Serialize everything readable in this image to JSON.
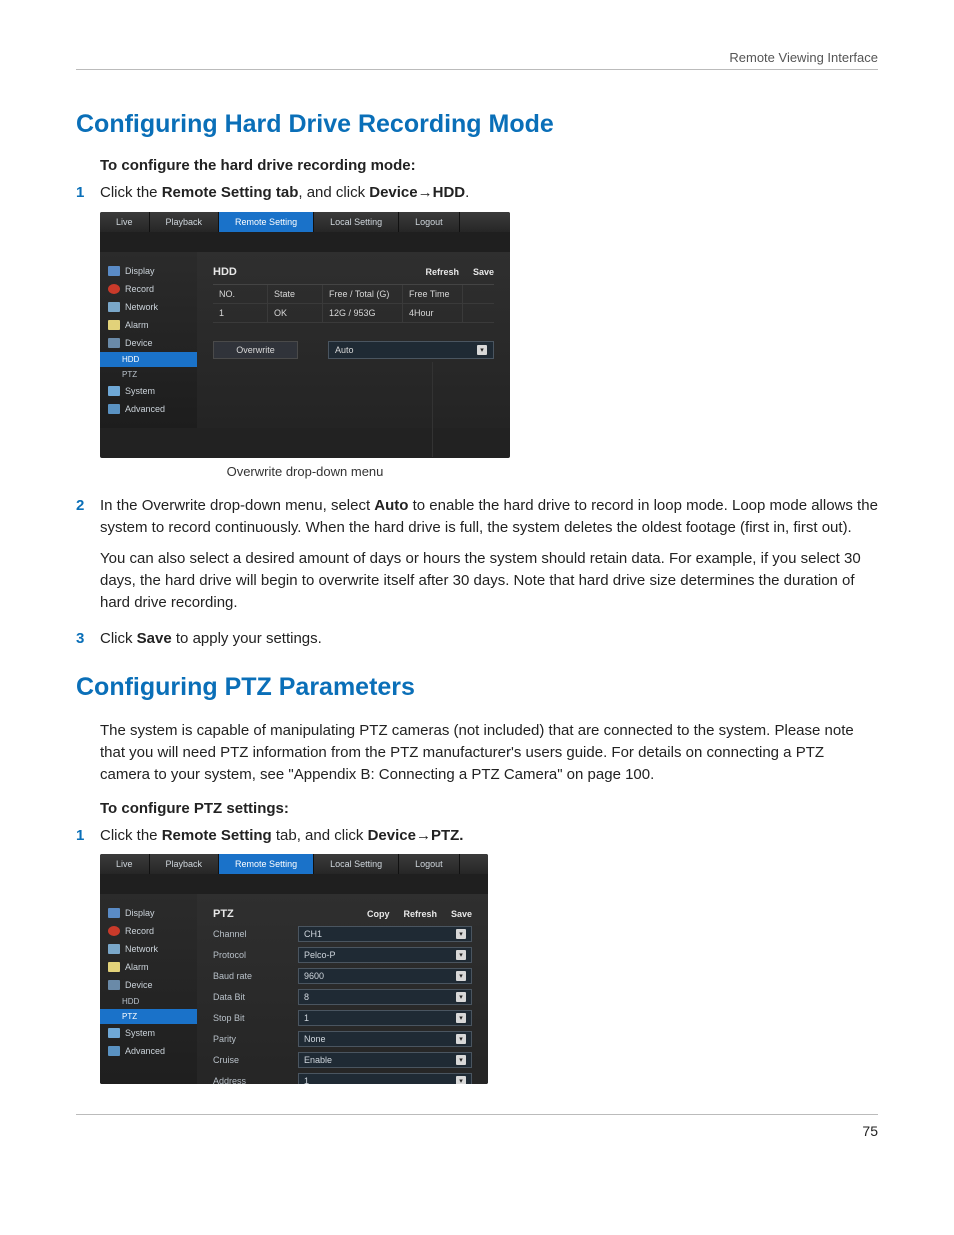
{
  "header": {
    "section": "Remote Viewing Interface"
  },
  "page_number": "75",
  "h1_a": "Configuring Hard Drive Recording Mode",
  "sub_a": "To configure the hard drive recording mode:",
  "step_a1_pre": "Click the ",
  "step_a1_b1": "Remote Setting tab",
  "step_a1_mid": ", and click ",
  "step_a1_b2": "Device→HDD",
  "step_a1_post": ".",
  "caption_a": "Overwrite drop-down menu",
  "step_a2_pre": "In the Overwrite drop-down menu, select ",
  "step_a2_b": "Auto",
  "step_a2_post": " to enable the hard drive to record in loop mode. Loop mode allows the system to record continuously. When the hard drive is full, the system deletes the oldest footage (first in, first out).",
  "para_a2b": "You can also select a desired amount of days or hours the system should retain data. For example, if you select 30 days, the hard drive will begin to overwrite itself after 30 days. Note that hard drive size determines the duration of hard drive recording.",
  "step_a3_pre": "Click ",
  "step_a3_b": "Save",
  "step_a3_post": " to apply your settings.",
  "h1_b": "Configuring PTZ Parameters",
  "para_b_intro": "The system is capable of manipulating PTZ cameras (not included) that are connected to the system. Please note that you will need PTZ information from the PTZ manufacturer's users guide. For details on connecting a PTZ camera to your system, see \"Appendix B: Connecting a PTZ Camera\" on page 100.",
  "sub_b": "To configure PTZ settings:",
  "step_b1_pre": "Click the ",
  "step_b1_b1": "Remote Setting",
  "step_b1_mid": " tab, and click ",
  "step_b1_b2": "Device→PTZ.",
  "mock": {
    "tabs": {
      "live": "Live",
      "playback": "Playback",
      "remote": "Remote Setting",
      "local": "Local Setting",
      "logout": "Logout"
    },
    "sidebar": {
      "display": "Display",
      "record": "Record",
      "network": "Network",
      "alarm": "Alarm",
      "device": "Device",
      "hdd": "HDD",
      "ptz": "PTZ",
      "system": "System",
      "advanced": "Advanced"
    },
    "hdd": {
      "title": "HDD",
      "refresh": "Refresh",
      "save": "Save",
      "h_no": "NO.",
      "h_state": "State",
      "h_free": "Free / Total (G)",
      "h_time": "Free Time",
      "r_no": "1",
      "r_state": "OK",
      "r_free": "12G / 953G",
      "r_time": "4Hour",
      "overwrite_lbl": "Overwrite",
      "overwrite_val": "Auto"
    },
    "ptz": {
      "title": "PTZ",
      "copy": "Copy",
      "refresh": "Refresh",
      "save": "Save",
      "rows": {
        "channel_k": "Channel",
        "channel_v": "CH1",
        "protocol_k": "Protocol",
        "protocol_v": "Pelco-P",
        "baud_k": "Baud rate",
        "baud_v": "9600",
        "databit_k": "Data Bit",
        "databit_v": "8",
        "stopbit_k": "Stop Bit",
        "stopbit_v": "1",
        "parity_k": "Parity",
        "parity_v": "None",
        "cruise_k": "Cruise",
        "cruise_v": "Enable",
        "address_k": "Address",
        "address_v": "1"
      }
    }
  }
}
